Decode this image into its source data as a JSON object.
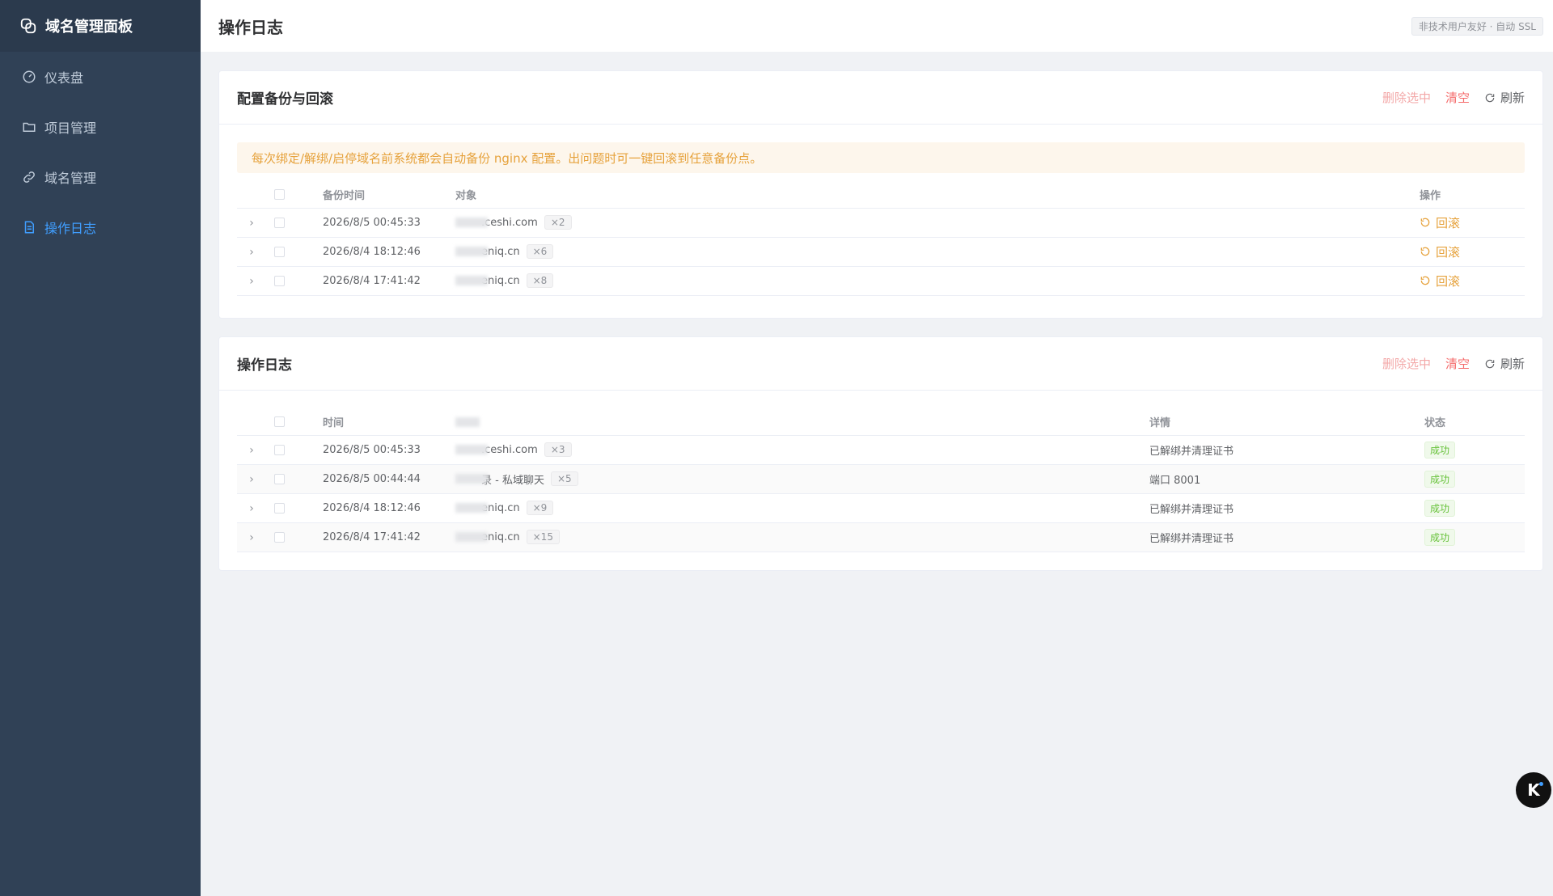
{
  "brand": {
    "title": "域名管理面板",
    "icon": "link-chain-icon"
  },
  "sidebar": {
    "items": [
      {
        "label": "仪表盘",
        "icon": "dashboard-icon",
        "active": false
      },
      {
        "label": "项目管理",
        "icon": "folder-icon",
        "active": false
      },
      {
        "label": "域名管理",
        "icon": "link-icon",
        "active": false
      },
      {
        "label": "操作日志",
        "icon": "document-icon",
        "active": true
      }
    ]
  },
  "header": {
    "title": "操作日志",
    "tag": "非技术用户友好 · 自动 SSL"
  },
  "backup": {
    "title": "配置备份与回滚",
    "actions": {
      "delete_selected": "删除选中",
      "clear": "清空",
      "refresh": "刷新"
    },
    "notice": "每次绑定/解绑/启停域名前系统都会自动备份 nginx 配置。出问题时可一键回滚到任意备份点。",
    "columns": {
      "time": "备份时间",
      "object": "对象",
      "op": "操作"
    },
    "rows": [
      {
        "time": "2026/8/5 00:45:33",
        "object": ".ceshi.com",
        "count": "×2",
        "op": "回滚"
      },
      {
        "time": "2026/8/4 18:12:46",
        "object": "eniq.cn",
        "count": "×6",
        "op": "回滚"
      },
      {
        "time": "2026/8/4 17:41:42",
        "object": "eniq.cn",
        "count": "×8",
        "op": "回滚"
      }
    ]
  },
  "logs": {
    "title": "操作日志",
    "actions": {
      "delete_selected": "删除选中",
      "clear": "清空",
      "refresh": "刷新"
    },
    "columns": {
      "time": "时间",
      "object": "",
      "detail": "详情",
      "status": "状态"
    },
    "rows": [
      {
        "time": "2026/8/5 00:45:33",
        "object": ".ceshi.com",
        "count": "×3",
        "detail": "已解绑并清理证书",
        "status": "成功"
      },
      {
        "time": "2026/8/5 00:44:44",
        "object": "录 - 私域聊天",
        "count": "×5",
        "detail": "端口 8001",
        "status": "成功"
      },
      {
        "time": "2026/8/4 18:12:46",
        "object": "eniq.cn",
        "count": "×9",
        "detail": "已解绑并清理证书",
        "status": "成功"
      },
      {
        "time": "2026/8/4 17:41:42",
        "object": "eniq.cn",
        "count": "×15",
        "detail": "已解绑并清理证书",
        "status": "成功"
      }
    ]
  },
  "colors": {
    "sidebar": "#304156",
    "accent": "#409eff",
    "warning": "#e6a23c",
    "danger": "#f56c6c",
    "success": "#67c23a"
  }
}
